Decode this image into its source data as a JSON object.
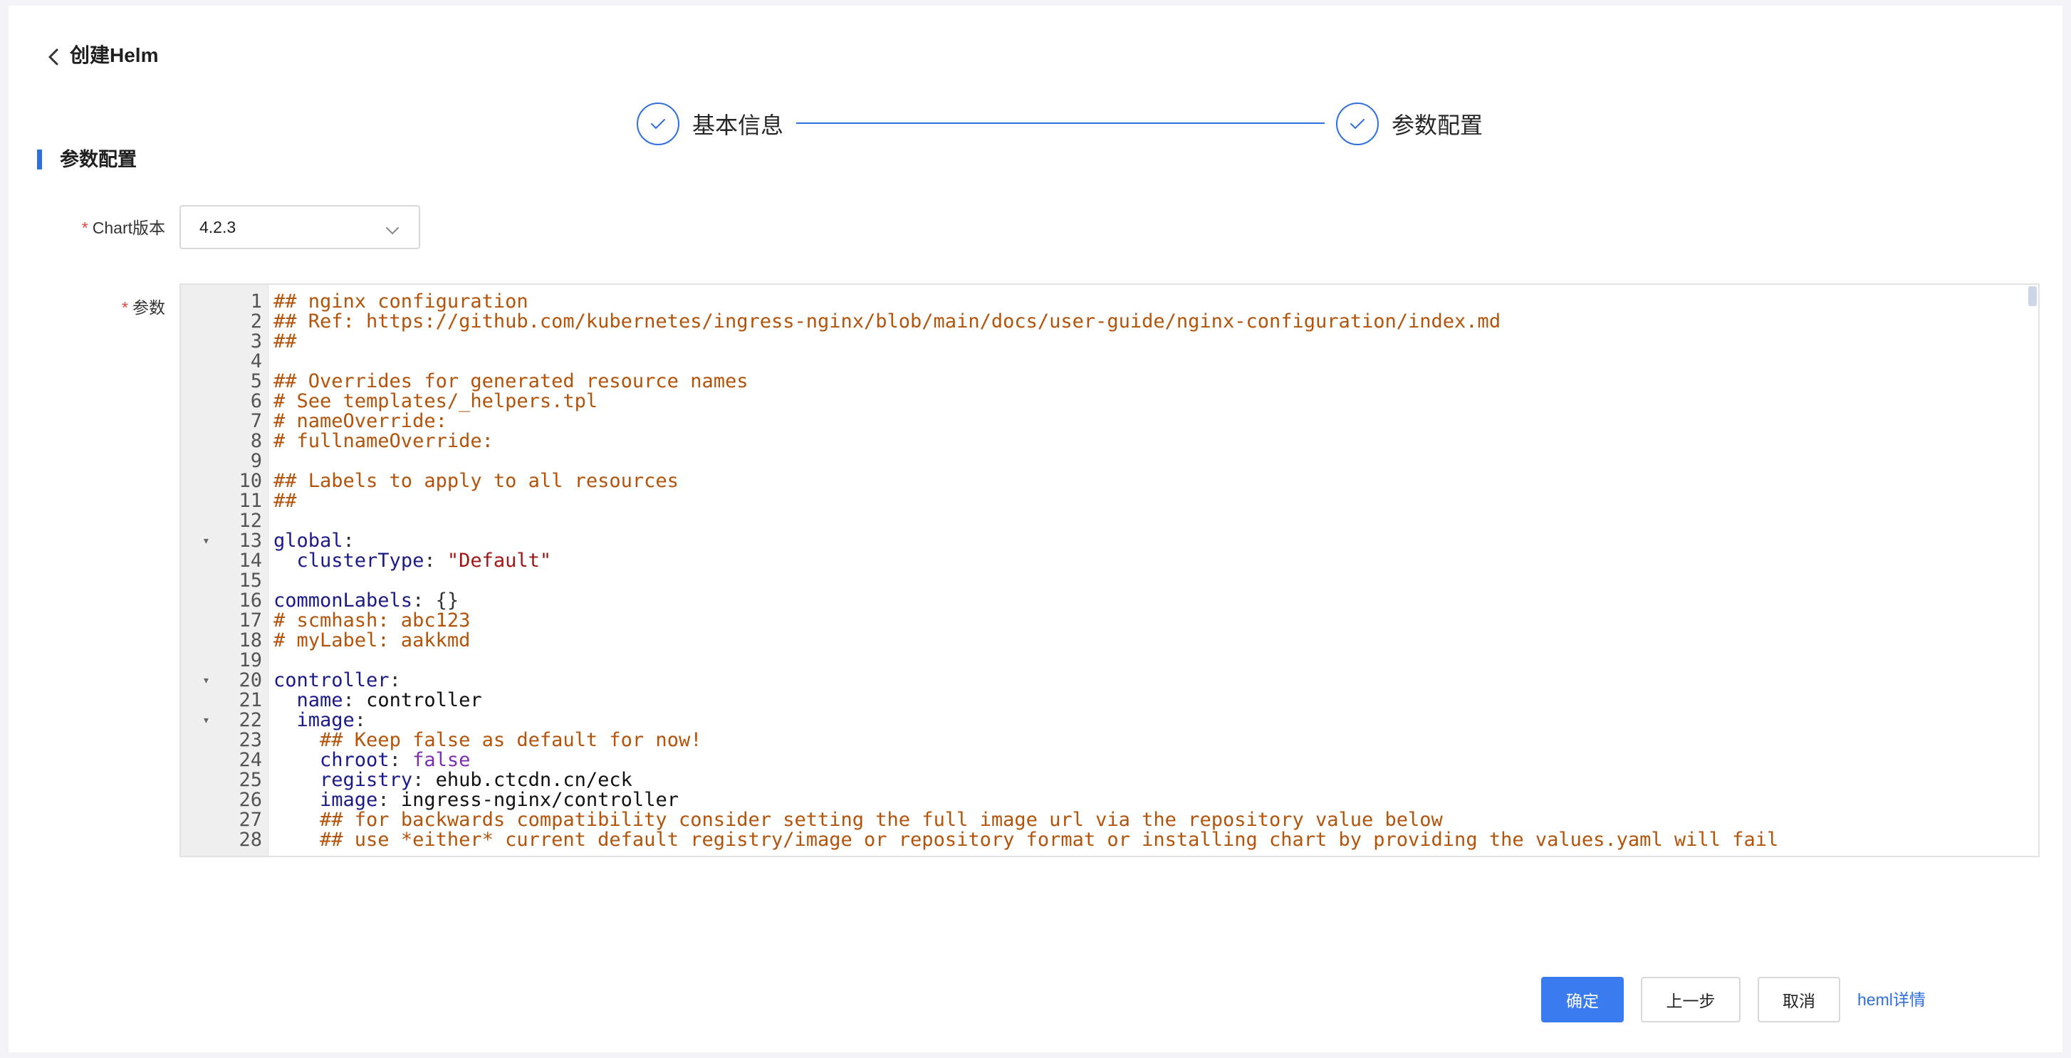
{
  "header": {
    "title": "创建Helm"
  },
  "steps": [
    {
      "label": "基本信息"
    },
    {
      "label": "参数配置"
    }
  ],
  "section": {
    "title": "参数配置"
  },
  "form": {
    "chart_version_label": "Chart版本",
    "chart_version_value": "4.2.3",
    "params_label": "参数",
    "required_mark": "*"
  },
  "editor": {
    "lines": [
      {
        "n": "1",
        "fold": "",
        "t": [
          [
            "c",
            "## nginx configuration"
          ]
        ]
      },
      {
        "n": "2",
        "fold": "",
        "t": [
          [
            "c",
            "## Ref: https://github.com/kubernetes/ingress-nginx/blob/main/docs/user-guide/nginx-configuration/index.md"
          ]
        ]
      },
      {
        "n": "3",
        "fold": "",
        "t": [
          [
            "c",
            "##"
          ]
        ]
      },
      {
        "n": "4",
        "fold": "",
        "t": []
      },
      {
        "n": "5",
        "fold": "",
        "t": [
          [
            "c",
            "## Overrides for generated resource names"
          ]
        ]
      },
      {
        "n": "6",
        "fold": "",
        "t": [
          [
            "c",
            "# See templates/_helpers.tpl"
          ]
        ]
      },
      {
        "n": "7",
        "fold": "",
        "t": [
          [
            "c",
            "# nameOverride:"
          ]
        ]
      },
      {
        "n": "8",
        "fold": "",
        "t": [
          [
            "c",
            "# fullnameOverride:"
          ]
        ]
      },
      {
        "n": "9",
        "fold": "",
        "t": []
      },
      {
        "n": "10",
        "fold": "",
        "t": [
          [
            "c",
            "## Labels to apply to all resources"
          ]
        ]
      },
      {
        "n": "11",
        "fold": "",
        "t": [
          [
            "c",
            "##"
          ]
        ]
      },
      {
        "n": "12",
        "fold": "",
        "t": []
      },
      {
        "n": "13",
        "fold": "▾",
        "t": [
          [
            "k",
            "global"
          ],
          [
            "p",
            ":"
          ]
        ]
      },
      {
        "n": "14",
        "fold": "",
        "t": [
          [
            "x",
            "  "
          ],
          [
            "k",
            "clusterType"
          ],
          [
            "p",
            ": "
          ],
          [
            "s",
            "\"Default\""
          ]
        ]
      },
      {
        "n": "15",
        "fold": "",
        "t": []
      },
      {
        "n": "16",
        "fold": "",
        "t": [
          [
            "k",
            "commonLabels"
          ],
          [
            "p",
            ": {}"
          ]
        ]
      },
      {
        "n": "17",
        "fold": "",
        "t": [
          [
            "c",
            "# scmhash: abc123"
          ]
        ]
      },
      {
        "n": "18",
        "fold": "",
        "t": [
          [
            "c",
            "# myLabel: aakkmd"
          ]
        ]
      },
      {
        "n": "19",
        "fold": "",
        "t": []
      },
      {
        "n": "20",
        "fold": "▾",
        "t": [
          [
            "k",
            "controller"
          ],
          [
            "p",
            ":"
          ]
        ]
      },
      {
        "n": "21",
        "fold": "",
        "t": [
          [
            "x",
            "  "
          ],
          [
            "k",
            "name"
          ],
          [
            "p",
            ": "
          ],
          [
            "x",
            "controller"
          ]
        ]
      },
      {
        "n": "22",
        "fold": "▾",
        "t": [
          [
            "x",
            "  "
          ],
          [
            "k",
            "image"
          ],
          [
            "p",
            ":"
          ]
        ]
      },
      {
        "n": "23",
        "fold": "",
        "t": [
          [
            "x",
            "    "
          ],
          [
            "c",
            "## Keep false as default for now!"
          ]
        ]
      },
      {
        "n": "24",
        "fold": "",
        "t": [
          [
            "x",
            "    "
          ],
          [
            "k",
            "chroot"
          ],
          [
            "p",
            ": "
          ],
          [
            "b",
            "false"
          ]
        ]
      },
      {
        "n": "25",
        "fold": "",
        "t": [
          [
            "x",
            "    "
          ],
          [
            "k",
            "registry"
          ],
          [
            "p",
            ": "
          ],
          [
            "x",
            "ehub.ctcdn.cn/eck"
          ]
        ]
      },
      {
        "n": "26",
        "fold": "",
        "t": [
          [
            "x",
            "    "
          ],
          [
            "k",
            "image"
          ],
          [
            "p",
            ": "
          ],
          [
            "x",
            "ingress-nginx/controller"
          ]
        ]
      },
      {
        "n": "27",
        "fold": "",
        "t": [
          [
            "x",
            "    "
          ],
          [
            "c",
            "## for backwards compatibility consider setting the full image url via the repository value below"
          ]
        ]
      },
      {
        "n": "28",
        "fold": "",
        "t": [
          [
            "x",
            "    "
          ],
          [
            "c",
            "## use *either* current default registry/image or repository format or installing chart by providing the values.yaml will fail"
          ]
        ]
      }
    ]
  },
  "footer": {
    "confirm": "确定",
    "prev": "上一步",
    "cancel": "取消",
    "details_link": "heml详情"
  },
  "colors": {
    "accent": "#2f6fe0",
    "primary_button": "#3b7bf0",
    "required": "#e6453b"
  }
}
